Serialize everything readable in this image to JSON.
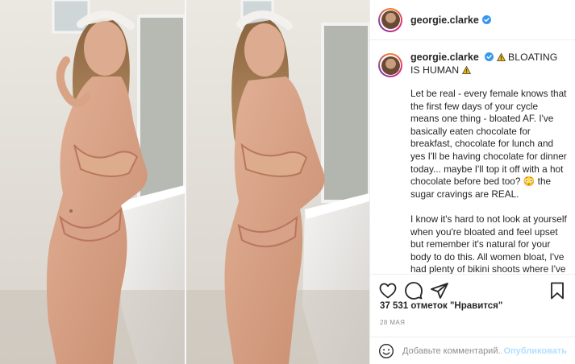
{
  "post": {
    "username": "georgie.clarke",
    "caption_title": "BLOATING IS HUMAN",
    "caption_text": "Let be real - every female knows that the first few days of your cycle means one thing - bloated AF. I've basically eaten chocolate for breakfast, chocolate for lunch and yes I'll be having chocolate for dinner today... maybe I'll top it off with a hot chocolate before bed too? 😳 the sugar cravings are REAL.\n\nI know it's hard to not look at yourself when you're bloated and feel upset but remember it's natural for your body to do this. All women bloat, I've had plenty of bikini shoots where I've been as bloated as I am in the right image but used as many flattering",
    "likes": "37 531 отметок \"Нравится\"",
    "date": "28 МАЯ",
    "comment_placeholder": "Добавьте комментарий...",
    "publish_label": "Опубликовать"
  },
  "icons": {
    "verified": "verified-badge-icon",
    "warning": "warning-icon",
    "like": "heart-icon",
    "comment": "comment-icon",
    "share": "share-icon",
    "save": "bookmark-icon",
    "emoji": "emoji-icon"
  },
  "colors": {
    "verified": "#3897f0",
    "publish_disabled": "#b2dffc",
    "warning": "#f5b400"
  }
}
